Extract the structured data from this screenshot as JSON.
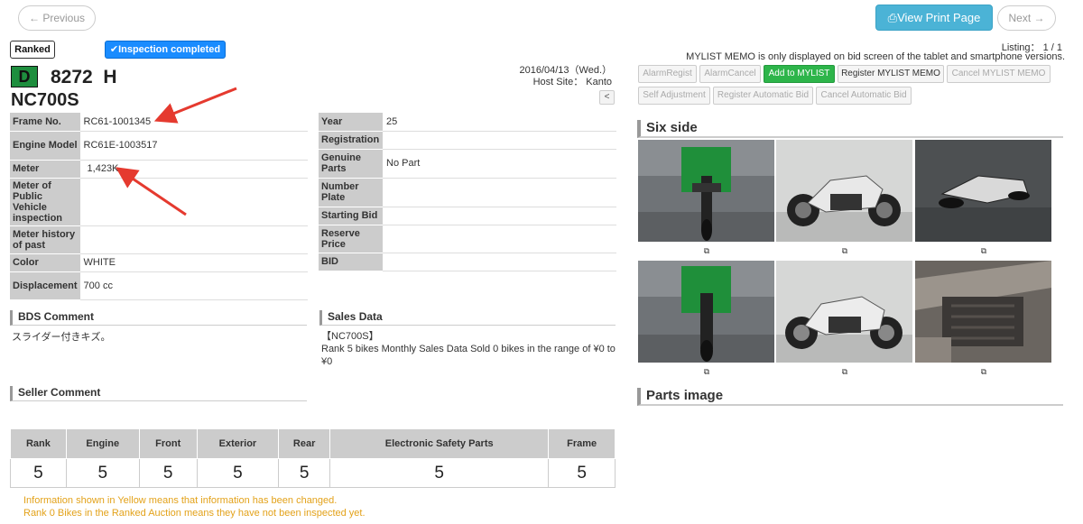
{
  "nav": {
    "prev_label": "← Previous",
    "next_label": "Next →",
    "print_label": "View Print Page"
  },
  "badges": {
    "ranked": "Ranked",
    "inspection": "Inspection completed"
  },
  "vehicle": {
    "grade": "D",
    "lot": "8272",
    "lot_suffix": "H",
    "model": "NC700S"
  },
  "meta": {
    "date": "2016/04/13（Wed.）",
    "host": "Host Site： Kanto",
    "collapse": "<"
  },
  "spec_left": [
    {
      "label": "Frame No.",
      "value": "RC61-1001345"
    },
    {
      "label": "Engine Model",
      "value": "RC61E-1003517"
    },
    {
      "label": "Meter",
      "value": "1,423K"
    },
    {
      "label": "Meter of Public Vehicle inspection",
      "value": ""
    },
    {
      "label": "Meter history of past",
      "value": ""
    },
    {
      "label": "Color",
      "value": "WHITE"
    },
    {
      "label": "Displacement",
      "value": "700 cc"
    }
  ],
  "spec_right": [
    {
      "label": "Year",
      "value": "25"
    },
    {
      "label": "Registration",
      "value": ""
    },
    {
      "label": "Genuine Parts",
      "value": "No Part"
    },
    {
      "label": "Number Plate",
      "value": ""
    },
    {
      "label": "Starting Bid",
      "value": ""
    },
    {
      "label": "Reserve Price",
      "value": ""
    },
    {
      "label": "BID",
      "value": ""
    }
  ],
  "sections": {
    "bds_title": "BDS Comment",
    "bds_text": "スライダー付きキズ。",
    "sales_title": "Sales Data",
    "sales_line1": "【NC700S】",
    "sales_line2": "Rank 5 bikes Monthly Sales Data Sold 0 bikes in the range of ¥0 to ¥0",
    "seller_title": "Seller Comment",
    "six_side_title": "Six side",
    "parts_title": "Parts image"
  },
  "grades": {
    "headers": [
      "Rank",
      "Engine",
      "Front",
      "Exterior",
      "Rear",
      "Electronic Safety Parts",
      "Frame"
    ],
    "values": [
      "5",
      "5",
      "5",
      "5",
      "5",
      "5",
      "5"
    ]
  },
  "notes": {
    "yellow": "Information shown in Yellow means that information has been changed.",
    "rank0": "Rank 0 Bikes in the Ranked Auction means they have not been inspected yet."
  },
  "listing": "Listing： 1 / 1",
  "mylist_memo": "MYLIST MEMO is only displayed on bid screen of the tablet and smartphone versions.",
  "actions": {
    "alarm_regist": "AlarmRegist",
    "alarm_cancel": "AlarmCancel",
    "add_mylist": "Add to MYLIST",
    "register_memo": "Register MYLIST MEMO",
    "cancel_memo": "Cancel MYLIST MEMO",
    "self_adjust": "Self Adjustment",
    "register_auto": "Register Automatic Bid",
    "cancel_auto": "Cancel Automatic Bid"
  },
  "colors": {
    "accent": "#4bb3d6",
    "green": "#2db54a",
    "inspection_blue": "#1a8cff",
    "grade_green": "#1e8e3e",
    "note_yellow": "#e3a21a",
    "arrow_red": "#e53a2f"
  }
}
